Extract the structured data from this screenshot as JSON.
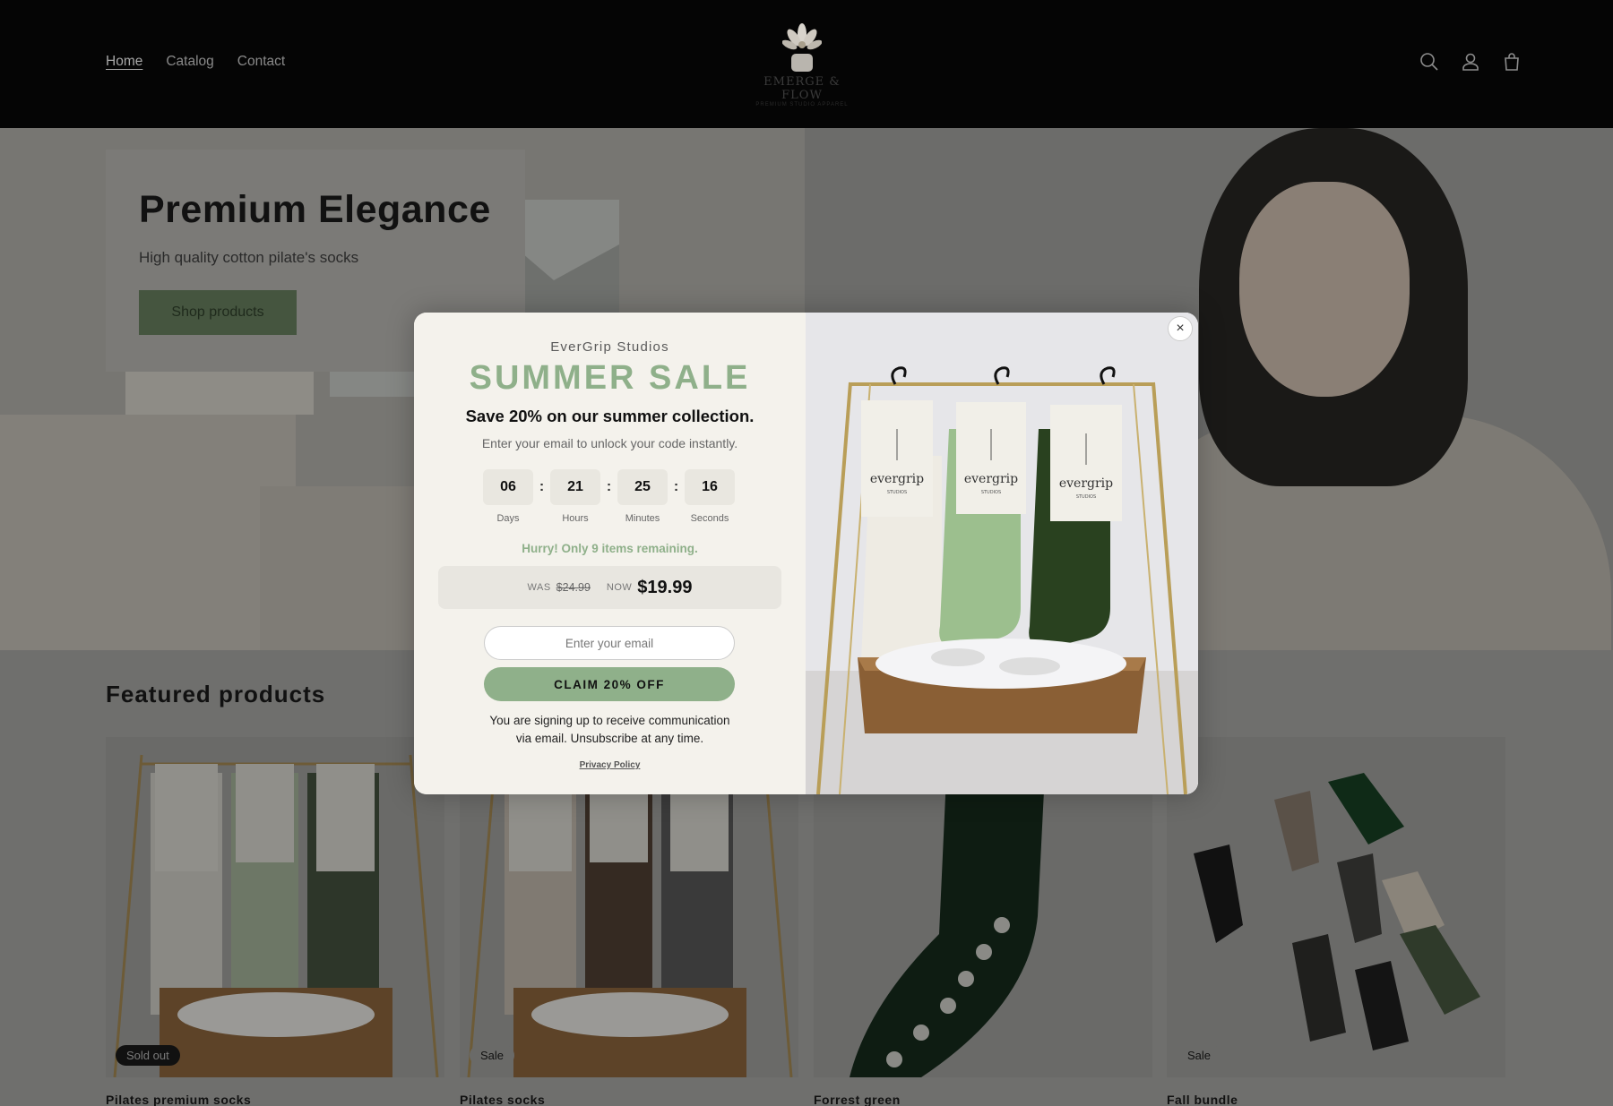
{
  "header": {
    "nav": [
      {
        "label": "Home",
        "active": true
      },
      {
        "label": "Catalog",
        "active": false
      },
      {
        "label": "Contact",
        "active": false
      }
    ],
    "logo": {
      "name": "EMERGE & FLOW",
      "tagline": "PREMIUM STUDIO APPAREL"
    },
    "icons": [
      "search-icon",
      "account-icon",
      "cart-icon"
    ]
  },
  "hero": {
    "title": "Premium Elegance",
    "subtitle": "High quality cotton pilate's socks",
    "button": "Shop products"
  },
  "featured": {
    "title": "Featured products",
    "products": [
      {
        "name": "Pilates premium socks",
        "badge": "Sold out",
        "badge_style": "dark"
      },
      {
        "name": "Pilates socks",
        "badge": "Sale",
        "badge_style": "light"
      },
      {
        "name": "Forrest green",
        "badge": "",
        "badge_style": ""
      },
      {
        "name": "Fall bundle",
        "badge": "Sale",
        "badge_style": "light"
      }
    ]
  },
  "popup": {
    "brand": "EverGrip Studios",
    "title": "SUMMER SALE",
    "headline": "Save 20% on our summer collection.",
    "subtext": "Enter your email to unlock your code instantly.",
    "timer": [
      {
        "value": "06",
        "label": "Days"
      },
      {
        "value": "21",
        "label": "Hours"
      },
      {
        "value": "25",
        "label": "Minutes"
      },
      {
        "value": "16",
        "label": "Seconds"
      }
    ],
    "urgency": "Hurry! Only 9 items remaining.",
    "was_label": "WAS",
    "was_price": "$24.99",
    "now_label": "NOW",
    "now_price": "$19.99",
    "email_placeholder": "Enter your email",
    "cta": "CLAIM 20% OFF",
    "consent": "You are signing up to receive communication via email. Unsubscribe at any time.",
    "privacy": "Privacy Policy",
    "close": "×",
    "product_label": "evergrip",
    "product_sublabel": "STUDIOS"
  },
  "colors": {
    "accent": "#8fb08a",
    "header_bg": "#050505",
    "button_dark": "#45553f"
  }
}
